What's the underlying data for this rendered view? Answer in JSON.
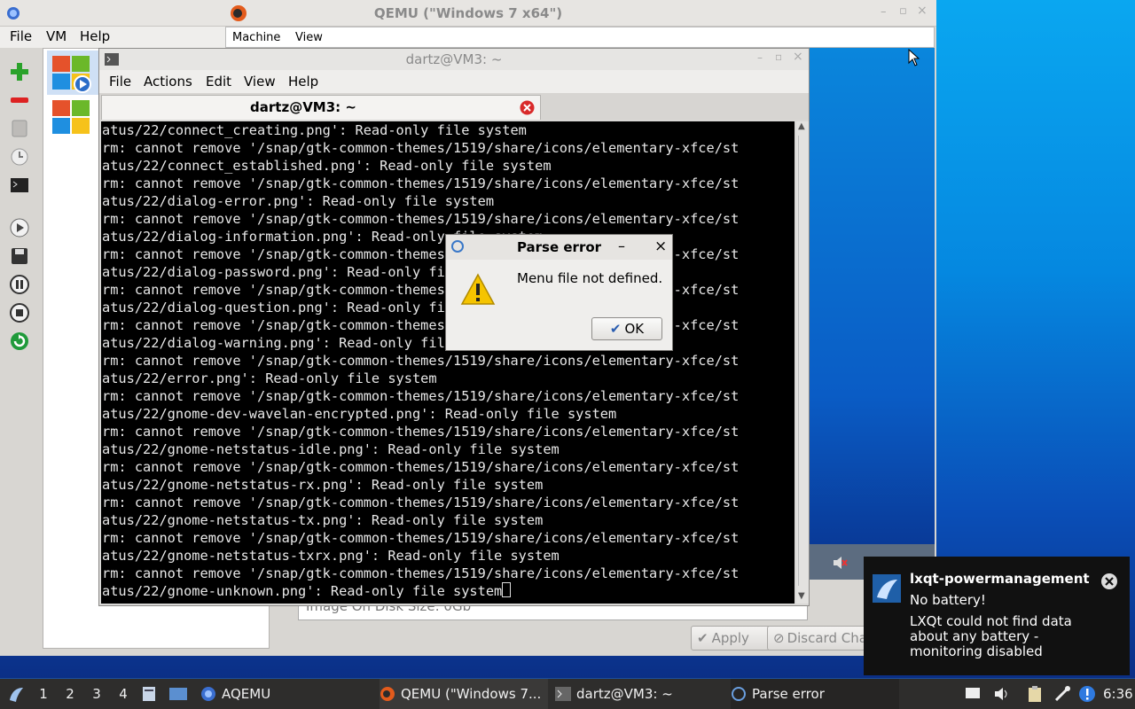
{
  "qemu": {
    "title": "QEMU (\"Windows 7 x64\")",
    "menu": [
      "File",
      "VM",
      "Help"
    ],
    "vm_menu": [
      "Machine",
      "View"
    ],
    "disk_size_text": "Image On Disk Size: 0Gb",
    "apply_label": "Apply",
    "discard_label": "Discard Cha"
  },
  "terminal": {
    "window_title": "dartz@VM3: ~",
    "menu": [
      "File",
      "Actions",
      "Edit",
      "View",
      "Help"
    ],
    "tab_title": "dartz@VM3: ~",
    "lines": [
      "atus/22/connect_creating.png': Read-only file system",
      "rm: cannot remove '/snap/gtk-common-themes/1519/share/icons/elementary-xfce/st",
      "atus/22/connect_established.png': Read-only file system",
      "rm: cannot remove '/snap/gtk-common-themes/1519/share/icons/elementary-xfce/st",
      "atus/22/dialog-error.png': Read-only file system",
      "rm: cannot remove '/snap/gtk-common-themes/1519/share/icons/elementary-xfce/st",
      "atus/22/dialog-information.png': Read-only file system",
      "rm: cannot remove '/snap/gtk-common-themes/1519/share/icons/elementary-xfce/st",
      "atus/22/dialog-password.png': Read-only file system",
      "rm: cannot remove '/snap/gtk-common-themes/1519/share/icons/elementary-xfce/st",
      "atus/22/dialog-question.png': Read-only file system",
      "rm: cannot remove '/snap/gtk-common-themes/1519/share/icons/elementary-xfce/st",
      "atus/22/dialog-warning.png': Read-only file system",
      "rm: cannot remove '/snap/gtk-common-themes/1519/share/icons/elementary-xfce/st",
      "atus/22/error.png': Read-only file system",
      "rm: cannot remove '/snap/gtk-common-themes/1519/share/icons/elementary-xfce/st",
      "atus/22/gnome-dev-wavelan-encrypted.png': Read-only file system",
      "rm: cannot remove '/snap/gtk-common-themes/1519/share/icons/elementary-xfce/st",
      "atus/22/gnome-netstatus-idle.png': Read-only file system",
      "rm: cannot remove '/snap/gtk-common-themes/1519/share/icons/elementary-xfce/st",
      "atus/22/gnome-netstatus-rx.png': Read-only file system",
      "rm: cannot remove '/snap/gtk-common-themes/1519/share/icons/elementary-xfce/st",
      "atus/22/gnome-netstatus-tx.png': Read-only file system",
      "rm: cannot remove '/snap/gtk-common-themes/1519/share/icons/elementary-xfce/st",
      "atus/22/gnome-netstatus-txrx.png': Read-only file system",
      "rm: cannot remove '/snap/gtk-common-themes/1519/share/icons/elementary-xfce/st",
      "atus/22/gnome-unknown.png': Read-only file system"
    ]
  },
  "dialog": {
    "title": "Parse error",
    "minimize_glyph": "–",
    "close_glyph": "×",
    "message": "Menu file not defined.",
    "ok_label": "OK"
  },
  "notification": {
    "title": "lxqt-powermanagement",
    "subtitle": "No battery!",
    "body": "LXQt could not find data about any battery - monitoring disabled"
  },
  "taskbar": {
    "workspaces": [
      "1",
      "2",
      "3",
      "4"
    ],
    "tasks": [
      "AQEMU",
      "QEMU (\"Windows 7...",
      "dartz@VM3: ~",
      "Parse error"
    ],
    "clock": "6:36"
  },
  "colors": {
    "taskbar_bg": "#2e2d2c",
    "terminal_bg": "#000000",
    "notification_bg": "#111111",
    "desktop_accent": "#0a86dc"
  }
}
